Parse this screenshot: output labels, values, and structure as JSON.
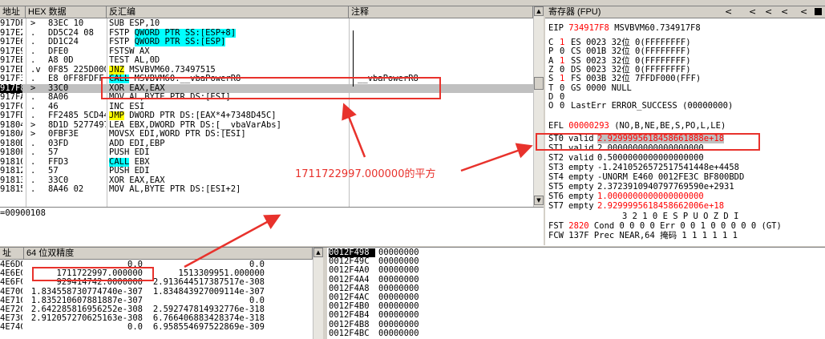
{
  "disasm": {
    "headers": {
      "addr": "地址",
      "hex": "HEX 数据",
      "asm": "反汇编",
      "comment": "注释"
    },
    "rows": [
      {
        "addr": "917DF",
        "dot": ">",
        "hex": "83EC 10",
        "asm": "SUB ESP,10",
        "comment": "",
        "style": "plain"
      },
      {
        "addr": "917E2",
        "dot": ".",
        "hex": "DD5C24 08",
        "asm_pre": "FSTP ",
        "asm_hl": "QWORD PTR SS:[ESP+8]",
        "asm_post": "",
        "hl": "cyan",
        "comment": ""
      },
      {
        "addr": "917E6",
        "dot": ".",
        "hex": "DD1C24",
        "asm_pre": "FSTP ",
        "asm_hl": "QWORD PTR SS:[ESP]",
        "asm_post": "",
        "hl": "cyan",
        "comment": ""
      },
      {
        "addr": "917E9",
        "dot": ".",
        "hex": "DFE0",
        "asm": "FSTSW AX",
        "comment": ""
      },
      {
        "addr": "917EB",
        "dot": ".",
        "hex": "A8 0D",
        "asm": "TEST AL,0D",
        "comment": ""
      },
      {
        "addr": "917ED",
        "dot": ".v",
        "hex": "0F85 225D000",
        "asm_pre": "",
        "asm_hl": "JNZ",
        "asm_post": " MSVBVM60.73497515",
        "hl": "yellow",
        "comment": ""
      },
      {
        "addr": "917F3",
        "dot": ".",
        "hex": "E8 0FF8FDFF",
        "asm_pre": "",
        "asm_hl": "CALL",
        "asm_post": " MSVBVM60.__vbaPowerR8",
        "hl": "cyan",
        "comment": "__vbaPowerR8"
      },
      {
        "addr": "917F8",
        "dot": ">",
        "hex": "33C0",
        "asm": "XOR EAX,EAX",
        "comment": "",
        "sel": true
      },
      {
        "addr": "917FA",
        "dot": ".",
        "hex": "8A06",
        "asm": "MOV AL,BYTE PTR DS:[ESI]",
        "comment": ""
      },
      {
        "addr": "917FC",
        "dot": ".",
        "hex": "46",
        "asm": "INC ESI",
        "comment": ""
      },
      {
        "addr": "917FD",
        "dot": ".",
        "hex": "FF2485 5CD44",
        "asm_pre": "",
        "asm_hl": "JMP",
        "asm_post": " DWORD PTR DS:[EAX*4+7348D45C]",
        "hl": "yellow",
        "comment": ""
      },
      {
        "addr": "91804",
        "dot": ">",
        "hex": "8D1D 5277497",
        "asm": "LEA EBX,DWORD PTR DS:[__vbaVarAbs]",
        "comment": ""
      },
      {
        "addr": "9180A",
        "dot": ">",
        "hex": "0FBF3E",
        "asm": "MOVSX EDI,WORD PTR DS:[ESI]",
        "comment": ""
      },
      {
        "addr": "9180D",
        "dot": ".",
        "hex": "03FD",
        "asm": "ADD EDI,EBP",
        "comment": ""
      },
      {
        "addr": "9180F",
        "dot": ".",
        "hex": "57",
        "asm": "PUSH EDI",
        "comment": ""
      },
      {
        "addr": "91810",
        "dot": ".",
        "hex": "FFD3",
        "asm_pre": "",
        "asm_hl": "CALL",
        "asm_post": " EBX",
        "hl": "cyan",
        "comment": ""
      },
      {
        "addr": "91812",
        "dot": ".",
        "hex": "57",
        "asm": "PUSH EDI",
        "comment": ""
      },
      {
        "addr": "91813",
        "dot": ".",
        "hex": "33C0",
        "asm": "XOR EAX,EAX",
        "comment": ""
      },
      {
        "addr": "91815",
        "dot": ".",
        "hex": "8A46 02",
        "asm": "MOV AL,BYTE PTR DS:[ESI+2]",
        "comment": ""
      }
    ],
    "infoline": "=00900108"
  },
  "registers": {
    "title": "寄存器 (FPU)",
    "nav": [
      "<",
      "<",
      "<",
      "<",
      "<"
    ],
    "eip": {
      "label": "EIP",
      "value": "734917F8",
      "desc": "MSVBVM60.734917F8"
    },
    "flags": [
      {
        "f": "C",
        "v": "1",
        "seg": "ES 0023 32位 0(FFFFFFFF)"
      },
      {
        "f": "P",
        "v": "0",
        "seg": "CS 001B 32位 0(FFFFFFFF)"
      },
      {
        "f": "A",
        "v": "1",
        "seg": "SS 0023 32位 0(FFFFFFFF)"
      },
      {
        "f": "Z",
        "v": "0",
        "seg": "DS 0023 32位 0(FFFFFFFF)"
      },
      {
        "f": "S",
        "v": "1",
        "seg": "FS 003B 32位 7FFDF000(FFF)"
      },
      {
        "f": "T",
        "v": "0",
        "seg": "GS 0000 NULL"
      },
      {
        "f": "D",
        "v": "0",
        "seg": ""
      },
      {
        "f": "O",
        "v": "0",
        "seg": "LastErr ERROR_SUCCESS (00000000)"
      }
    ],
    "efl": {
      "label": "EFL",
      "value": "00000293",
      "desc": "(NO,B,NE,BE,S,PO,L,LE)"
    },
    "st": [
      {
        "n": "ST0",
        "tag": "valid",
        "val": "2.9299995618458661888e+18",
        "red": true
      },
      {
        "n": "ST1",
        "tag": "valid",
        "val": "2.0000000000000000000",
        "red": false
      },
      {
        "n": "ST2",
        "tag": "valid",
        "val": "0.5000000000000000000",
        "red": false
      },
      {
        "n": "ST3",
        "tag": "empty",
        "val": "-1.2410526572517541448e+4458",
        "red": false
      },
      {
        "n": "ST4",
        "tag": "empty",
        "val": "-UNORM E460 0012FE3C BF800BDD",
        "red": false
      },
      {
        "n": "ST5",
        "tag": "empty",
        "val": "2.3723910940797769590e+2931",
        "red": false
      },
      {
        "n": "ST6",
        "tag": "empty",
        "val": "1.0000000000000000000",
        "red": true
      },
      {
        "n": "ST7",
        "tag": "empty",
        "val": "2.9299995618458662006e+18",
        "red": true
      }
    ],
    "bits_header": "3 2 1 0      E S P U O Z D I",
    "fst": {
      "label": "FST",
      "value": "2820",
      "rest": "Cond 0 0 0 0  Err 0 0 1 0 0 0 0 0  (GT)"
    },
    "fcw": {
      "label": "FCW",
      "value": "137F",
      "rest": "Prec NEAR,64  掩码    1 1 1 1 1 1"
    }
  },
  "dump": {
    "header_addr": "址",
    "header_title": "64 位双精度",
    "rows": [
      {
        "addr": "4E6DC",
        "c1": "0.0",
        "c2": "0.0"
      },
      {
        "addr": "4E6EC",
        "c1": "1711722997.000000",
        "c2": "1513309951.000000"
      },
      {
        "addr": "4E6FC",
        "c1": "929414742.0000000",
        "c2": "2.913644517387517e-308"
      },
      {
        "addr": "4E70C",
        "c1": "1.834558730774740e-307",
        "c2": "1.834843927009114e-307"
      },
      {
        "addr": "4E71C",
        "c1": "1.835210607881887e-307",
        "c2": "0.0"
      },
      {
        "addr": "4E72C",
        "c1": "2.642285816956252e-308",
        "c2": "2.592747814932776e-318"
      },
      {
        "addr": "4E73C",
        "c1": "2.912057270625163e-308",
        "c2": "6.766406883428374e-318"
      },
      {
        "addr": "4E74C",
        "c1": "0.0",
        "c2": "6.958554697522869e-309"
      }
    ]
  },
  "stack": {
    "rows": [
      {
        "addr": "0012F498",
        "val": "00000000",
        "sel": true
      },
      {
        "addr": "0012F49C",
        "val": "00000000"
      },
      {
        "addr": "0012F4A0",
        "val": "00000000"
      },
      {
        "addr": "0012F4A4",
        "val": "00000000"
      },
      {
        "addr": "0012F4A8",
        "val": "00000000"
      },
      {
        "addr": "0012F4AC",
        "val": "00000000"
      },
      {
        "addr": "0012F4B0",
        "val": "00000000"
      },
      {
        "addr": "0012F4B4",
        "val": "00000000"
      },
      {
        "addr": "0012F4B8",
        "val": "00000000"
      },
      {
        "addr": "0012F4BC",
        "val": "00000000"
      }
    ]
  },
  "annotation": {
    "text": "1711722997.000000的平方",
    "color": "#e8322c"
  },
  "colors": {
    "highlight_yellow": "#ffff00",
    "highlight_cyan": "#00ffff",
    "accent_red": "#ff0000",
    "annotation": "#e8322c"
  }
}
